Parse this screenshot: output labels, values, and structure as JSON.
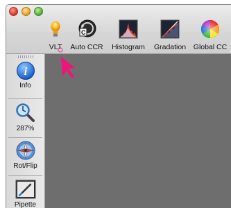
{
  "toolbar": {
    "items": [
      {
        "label": "VLT",
        "icon": "lightbulb-icon"
      },
      {
        "label": "Auto CCR",
        "icon": "auto-ccr-icon"
      },
      {
        "label": "Histogram",
        "icon": "histogram-icon"
      },
      {
        "label": "Gradation",
        "icon": "gradation-icon"
      },
      {
        "label": "Global CC",
        "icon": "color-wheel-icon"
      }
    ]
  },
  "sidebar": {
    "items": [
      {
        "label": "Info",
        "icon": "info-icon"
      },
      {
        "label": "287%",
        "icon": "zoom-magnifier-icon"
      },
      {
        "label": "Rot/Flip",
        "icon": "compass-icon"
      },
      {
        "label": "Pipette",
        "icon": "pipette-icon"
      }
    ]
  },
  "colors": {
    "canvas": "#6e6e6e",
    "cursor": "#f0147a"
  }
}
